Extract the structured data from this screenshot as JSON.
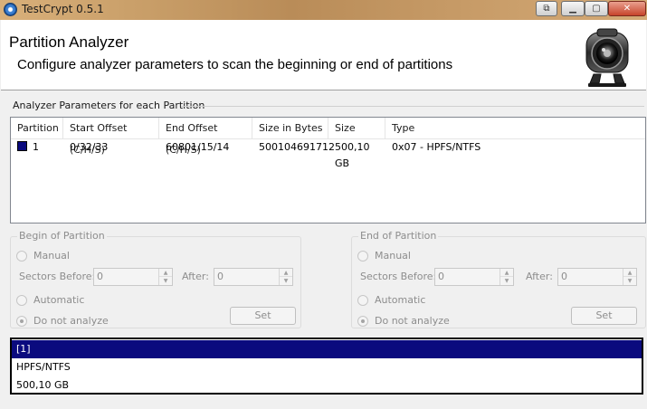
{
  "window": {
    "title": "TestCrypt 0.5.1",
    "restore_label": "⧉",
    "minimize_label": "▁",
    "maximize_label": "▢",
    "close_label": "✕"
  },
  "header": {
    "title": "Partition Analyzer",
    "subtitle": "Configure analyzer parameters to scan the beginning or end of partitions"
  },
  "group_label": "Analyzer Parameters for each Partition",
  "table": {
    "columns": [
      "Partition",
      "Start Offset (C/H/S)",
      "End Offset (C/H/S)",
      "Size in Bytes",
      "Size",
      "Type"
    ],
    "rows": [
      {
        "partition": "1",
        "color": "#0a0a7e",
        "start": "0/32/33",
        "end": "60801/15/14",
        "bytes": "500104691712",
        "size": "500,10 GB",
        "type": "0x07 - HPFS/NTFS"
      }
    ]
  },
  "begin": {
    "title": "Begin of Partition",
    "manual": "Manual",
    "sectors_before": "Sectors Before:",
    "sectors_before_value": "0",
    "after": "After:",
    "after_value": "0",
    "automatic": "Automatic",
    "do_not_analyze": "Do not analyze",
    "set": "Set"
  },
  "end": {
    "title": "End of Partition",
    "manual": "Manual",
    "sectors_before": "Sectors Before:",
    "sectors_before_value": "0",
    "after": "After:",
    "after_value": "0",
    "automatic": "Automatic",
    "do_not_analyze": "Do not analyze",
    "set": "Set"
  },
  "details": [
    "[1]",
    "HPFS/NTFS",
    "500,10 GB"
  ],
  "colors": {
    "accent": "#0a0a7e",
    "disabled_text": "#8d8d8d"
  }
}
